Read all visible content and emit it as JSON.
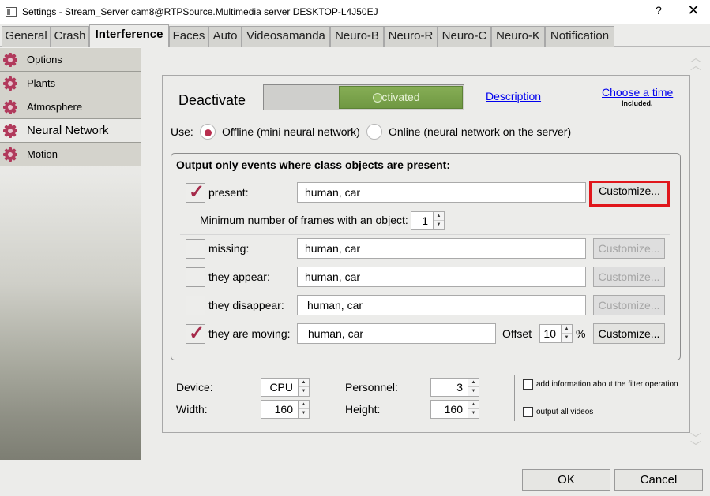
{
  "window": {
    "title": "Settings - Stream_Server cam8@RTPSource.Multimedia server DESKTOP-L4J50EJ",
    "help": "?",
    "close": "✕"
  },
  "tabs": [
    {
      "label": "General"
    },
    {
      "label": "Crash"
    },
    {
      "label": "Interference",
      "active": true
    },
    {
      "label": "Faces"
    },
    {
      "label": "Auto"
    },
    {
      "label": "Videosamanda"
    },
    {
      "label": "Neuro-B"
    },
    {
      "label": "Neuro-R"
    },
    {
      "label": "Neuro-C"
    },
    {
      "label": "Neuro-K"
    },
    {
      "label": "Notification"
    }
  ],
  "sidebar": {
    "items": [
      {
        "label": "Options"
      },
      {
        "label": "Plants"
      },
      {
        "label": "Atmosphere"
      },
      {
        "label": "Neural Network",
        "active": true
      },
      {
        "label": "Motion"
      }
    ]
  },
  "header": {
    "deactivate": "Deactivate",
    "toggle_state": "Activated",
    "description_link": "Description",
    "choose_time_link": "Choose a time",
    "included": "Included."
  },
  "use": {
    "label": "Use:",
    "offline": "Offline (mini neural network)",
    "online": "Online (neural network on the server)",
    "selected": "offline"
  },
  "filter": {
    "title": "Output only events where class objects are present:",
    "rows": [
      {
        "label": "present:",
        "checked": true,
        "value": "human, car",
        "button": "Customize..."
      },
      {
        "label": "missing:",
        "checked": false,
        "value": "human, car",
        "button": "Customize..."
      },
      {
        "label": "they appear:",
        "checked": false,
        "value": "human, car",
        "button": "Customize..."
      },
      {
        "label": "they disappear:",
        "checked": false,
        "value": "human, car",
        "button": "Customize..."
      },
      {
        "label": "they are moving:",
        "checked": true,
        "value": "human, car",
        "button": "Customize..."
      }
    ],
    "min_frames_label": "Minimum number of frames with an object:",
    "min_frames_value": "1",
    "offset_label": "Offset",
    "offset_value": "10",
    "offset_unit": "%"
  },
  "settings": {
    "device_label": "Device:",
    "device_value": "CPU",
    "personnel_label": "Personnel:",
    "personnel_value": "3",
    "width_label": "Width:",
    "width_value": "160",
    "height_label": "Height:",
    "height_value": "160",
    "add_info_label": "add information about the filter operation",
    "output_all_label": "output all videos"
  },
  "footer": {
    "ok": "OK",
    "cancel": "Cancel"
  },
  "colors": {
    "accent_red": "#e0161b",
    "toggle_green": "#7aa34b",
    "gear": "#b13a5c",
    "link": "#0000ee"
  }
}
